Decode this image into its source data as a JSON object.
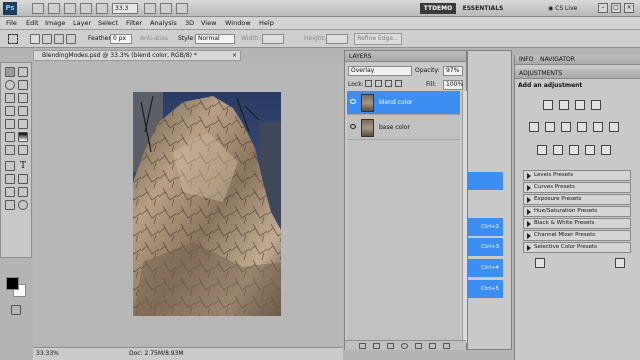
{
  "app": {
    "logo": "Ps",
    "zoom": "33.3",
    "workspaces": [
      "TTDEMO",
      "ESSENTIALS"
    ],
    "cslive": "CS Live"
  },
  "menu": [
    "File",
    "Edit",
    "Image",
    "Layer",
    "Select",
    "Filter",
    "Analysis",
    "3D",
    "View",
    "Window",
    "Help"
  ],
  "options": {
    "feather_label": "Feather:",
    "feather_value": "0 px",
    "antialias": "Anti-alias",
    "style_label": "Style:",
    "style_value": "Normal",
    "width_label": "Width:",
    "height_label": "Height:",
    "refine": "Refine Edge..."
  },
  "document": {
    "tab_title": "BlendingModes.psd @ 33.3% (blend color, RGB/8) *",
    "close": "×",
    "status_zoom": "33.33%",
    "status_doc": "Doc: 2.75M/8.93M"
  },
  "layers_panel": {
    "title": "LAYERS",
    "blend_mode": "Overlay",
    "opacity_label": "Opacity:",
    "opacity_value": "97%",
    "lock_label": "Lock:",
    "fill_label": "Fill:",
    "fill_value": "100%",
    "layers": [
      {
        "name": "blend color",
        "selected": true
      },
      {
        "name": "base color",
        "selected": false
      }
    ]
  },
  "shortcuts": [
    "Ctrl+2",
    "Ctrl+3",
    "Ctrl+4",
    "Ctrl+5"
  ],
  "adjustments": {
    "tabs": [
      "INFO",
      "NAVIGATOR"
    ],
    "title": "ADJUSTMENTS",
    "heading": "Add an adjustment",
    "presets": [
      "Levels Presets",
      "Curves Presets",
      "Exposure Presets",
      "Hue/Saturation Presets",
      "Black & White Presets",
      "Channel Mixer Presets",
      "Selective Color Presets"
    ]
  },
  "colors": {
    "selection_blue": "#3d8ef2",
    "panel_gray": "#c9c9c9"
  }
}
